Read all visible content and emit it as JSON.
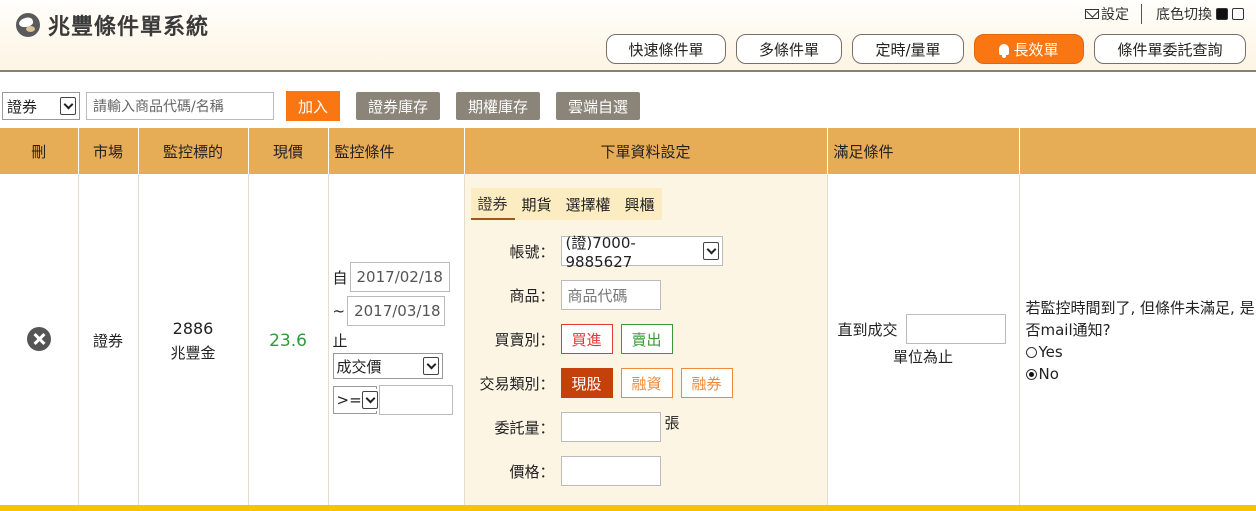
{
  "app": {
    "title": "兆豐條件單系統"
  },
  "top_links": {
    "settings": "設定",
    "theme_switch": "底色切換"
  },
  "nav": {
    "items": [
      "快速條件單",
      "多條件單",
      "定時/量單",
      "長效單",
      "條件單委託查詢"
    ],
    "active": "長效單"
  },
  "toolbar": {
    "market_select": "證券",
    "search_placeholder": "請輸入商品代碼/名稱",
    "add_label": "加入",
    "stock_inventory": "證券庫存",
    "option_inventory": "期權庫存",
    "cloud_watchlist": "雲端自選"
  },
  "table": {
    "headers": [
      "刪",
      "市場",
      "監控標的",
      "現價",
      "監控條件",
      "下單資料設定",
      "滿足條件",
      ""
    ],
    "row": {
      "market": "證券",
      "code": "2886",
      "name": "兆豐金",
      "price": "23.6",
      "monitor": {
        "from_label": "自",
        "from_date": "2017/02/18",
        "to_prefix": "~",
        "to_date": "2017/03/18",
        "until_label": "止",
        "price_type": "成交價",
        "operator": ">=",
        "value": ""
      },
      "order": {
        "tabs": [
          "證券",
          "期貨",
          "選擇權",
          "興櫃"
        ],
        "active_tab": "證券",
        "account_label": "帳號：",
        "account_value": "(證)7000-9885627",
        "product_label": "商品：",
        "product_placeholder": "商品代碼",
        "side_label": "買賣別：",
        "buy": "買進",
        "sell": "賣出",
        "trade_type_label": "交易類別：",
        "cash": "現股",
        "margin": "融資",
        "short": "融券",
        "qty_label": "委託量：",
        "qty_unit": "張",
        "price_label": "價格："
      },
      "condition": {
        "until_filled": "直到成交",
        "unit_text": "單位為止"
      },
      "notify": {
        "question": "若監控時間到了, 但條件未滿足, 是否mail通知?",
        "yes": "Yes",
        "no": "No",
        "selected": "No"
      }
    }
  },
  "colors": {
    "accent_orange": "#f97612",
    "header_gold": "#e7ad56",
    "price_green": "#2e9b3a",
    "bottom_bar": "#f5c400"
  }
}
